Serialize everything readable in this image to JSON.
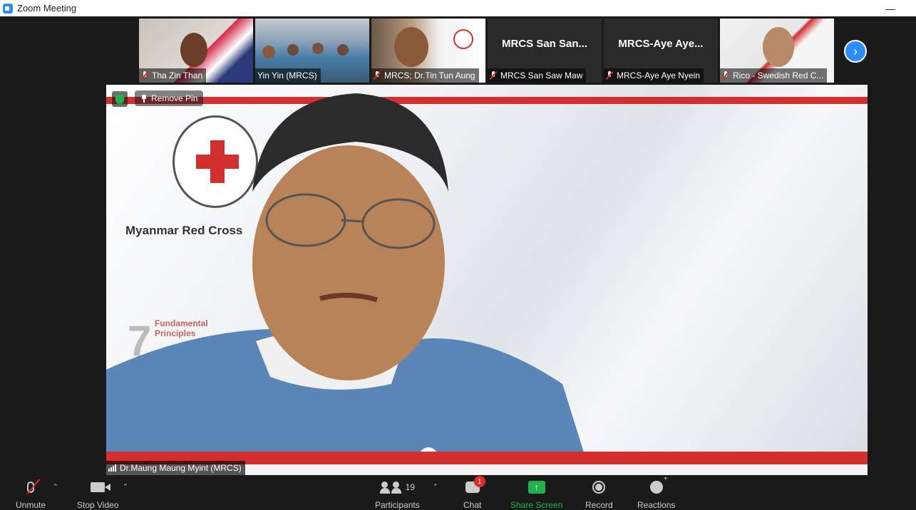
{
  "window": {
    "title": "Zoom Meeting",
    "minimize_glyph": "—"
  },
  "thumbnails": [
    {
      "name": "Tha Zin Than",
      "muted": true,
      "video": true
    },
    {
      "name": "Yin Yin (MRCS)",
      "muted": false,
      "video": true
    },
    {
      "name": "MRCS; Dr.Tin Tun Aung",
      "muted": true,
      "video": true
    },
    {
      "name": "MRCS San Saw Maw",
      "big_label": "MRCS San San...",
      "muted": true,
      "video": false
    },
    {
      "name": "MRCS-Aye Aye Nyein",
      "big_label": "MRCS-Aye Aye...",
      "muted": true,
      "video": false
    },
    {
      "name": "Rico - Swedish Red C...",
      "muted": true,
      "video": true
    }
  ],
  "pinned": {
    "remove_pin_label": "Remove Pin",
    "speaker_name": "Dr.Maung Maung Myint (MRCS)",
    "background_org": "Myanmar Red Cross",
    "background_number": "7",
    "background_principles": "Fundamental Principles"
  },
  "toolbar": {
    "unmute": "Unmute",
    "stop_video": "Stop Video",
    "participants": "Participants",
    "participants_count": "19",
    "chat": "Chat",
    "chat_badge": "1",
    "share_screen": "Share Screen",
    "record": "Record",
    "reactions": "Reactions"
  },
  "colors": {
    "accent": "#2d8cff",
    "share": "#22b14c",
    "alert": "#e02828",
    "redcross": "#d32f2f"
  }
}
